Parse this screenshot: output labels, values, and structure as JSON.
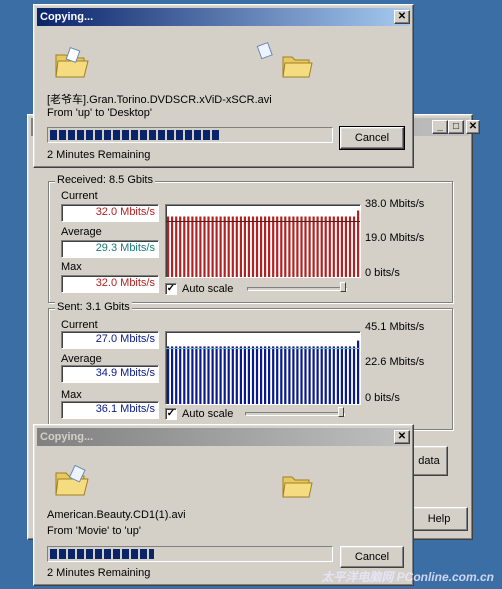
{
  "top_dialog": {
    "title": "Copying...",
    "close_glyph": "✕",
    "file_name": "[老爷车].Gran.Torino.DVDSCR.xViD-xSCR.avi",
    "from_to": "From 'up' to 'Desktop'",
    "cancel_label": "Cancel",
    "remaining": "2 Minutes Remaining",
    "progress_fraction": 0.61
  },
  "monitor": {
    "window_buttons": {
      "minimize": "_",
      "maximize": "□",
      "close": "✕"
    },
    "received": {
      "group_label": "Received: 8.5 Gbits",
      "current_label": "Current",
      "current_value": "32.0 Mbits/s",
      "average_label": "Average",
      "average_value": "29.3 Mbits/s",
      "max_label": "Max",
      "max_value": "32.0 Mbits/s",
      "axis_top": "38.0 Mbits/s",
      "axis_mid": "19.0 Mbits/s",
      "axis_bottom": "0  bits/s",
      "auto_scale_label": "Auto scale",
      "auto_scale_checked": "✓",
      "bar_color": "#b22222",
      "bar_level": 0.84,
      "avg_level": 0.77
    },
    "sent": {
      "group_label": "Sent: 3.1 Gbits",
      "current_label": "Current",
      "current_value": "27.0 Mbits/s",
      "average_label": "Average",
      "average_value": "34.9 Mbits/s",
      "max_label": "Max",
      "max_value": "36.1 Mbits/s",
      "axis_top": "45.1 Mbits/s",
      "axis_mid": "22.6 Mbits/s",
      "axis_bottom": "0  bits/s",
      "auto_scale_label": "Auto scale",
      "auto_scale_checked": "✓",
      "bar_color": "#0a1a8a",
      "bar_level": 0.8,
      "avg_level": 0.77
    },
    "data_button_label": "data",
    "help_button_label": "Help"
  },
  "bottom_dialog": {
    "title": "Copying...",
    "close_glyph": "✕",
    "file_name": "American.Beauty.CD1(1).avi",
    "from_to": "From 'Movie' to 'up'",
    "cancel_label": "Cancel",
    "remaining": "2 Minutes Remaining",
    "progress_fraction": 0.38
  },
  "watermark": "太平洋电脑网 PConline.com.cn"
}
